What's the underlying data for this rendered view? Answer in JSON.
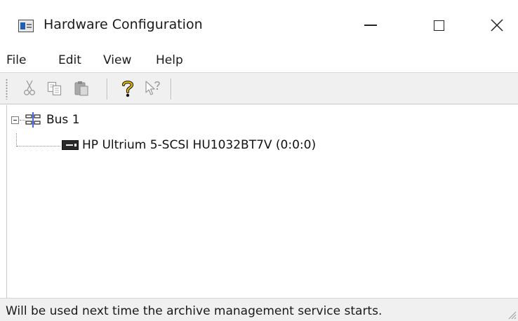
{
  "window": {
    "title": "Hardware Configuration",
    "controls": {
      "minimize_glyph": "—",
      "maximize_glyph": "□",
      "close_glyph": "✕"
    }
  },
  "menu": {
    "items": [
      {
        "label": "File"
      },
      {
        "label": "Edit"
      },
      {
        "label": "View"
      },
      {
        "label": "Help"
      }
    ]
  },
  "toolbar": {
    "buttons": [
      {
        "icon": "cut-icon",
        "enabled": false
      },
      {
        "icon": "copy-icon",
        "enabled": false
      },
      {
        "icon": "paste-icon",
        "enabled": false
      },
      {
        "icon": "help-icon",
        "enabled": true
      },
      {
        "icon": "context-help-icon",
        "enabled": false
      }
    ],
    "colors": {
      "help_accent": "#d9b100",
      "disabled": "#a0a0a0"
    }
  },
  "tree": {
    "nodes": [
      {
        "label": "Bus 1",
        "expanded": true,
        "icon": "bus-icon",
        "children": [
          {
            "label": "HP Ultrium 5-SCSI HU1032BT7V (0:0:0)",
            "icon": "tape-drive-icon"
          }
        ]
      }
    ]
  },
  "status": {
    "text": "Will be used next time the archive management service starts."
  }
}
